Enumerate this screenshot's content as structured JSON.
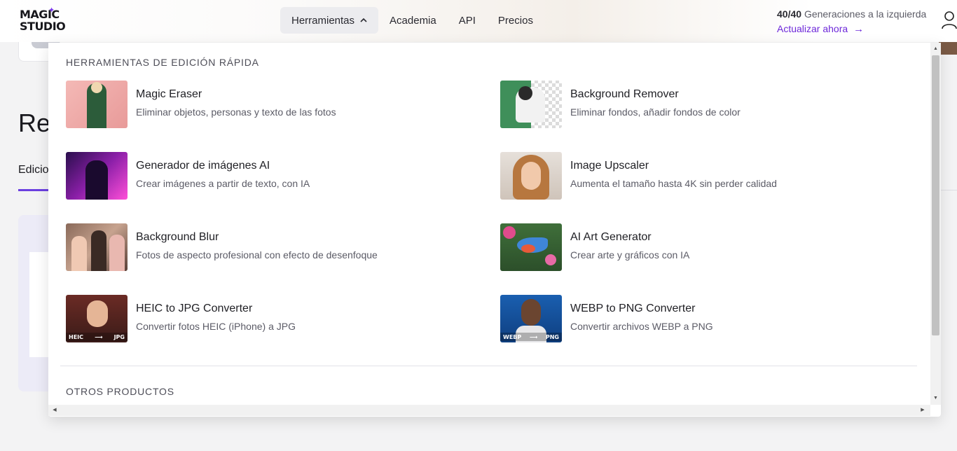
{
  "header": {
    "logo_line1": "MAGIC",
    "logo_line2": "STUDIO",
    "nav": [
      {
        "label": "Herramientas",
        "active": true
      },
      {
        "label": "Academia"
      },
      {
        "label": "API"
      },
      {
        "label": "Precios"
      }
    ],
    "generations_count": "40/40",
    "generations_text": "Generaciones a la izquierda",
    "upgrade_label": "Actualizar ahora",
    "accent_color": "#6d28d9"
  },
  "background": {
    "heading": "Rec",
    "tab_label": "Edicio"
  },
  "dropdown": {
    "section_quick": "HERRAMIENTAS DE EDICIÓN RÁPIDA",
    "section_other": "OTROS PRODUCTOS",
    "tools": [
      {
        "title": "Magic Eraser",
        "desc": "Eliminar objetos, personas y texto de las fotos",
        "icon": "magic-eraser-thumbnail"
      },
      {
        "title": "Background Remover",
        "desc": "Eliminar fondos, añadir fondos de color",
        "icon": "background-remover-thumbnail"
      },
      {
        "title": "Generador de imágenes AI",
        "desc": "Crear imágenes a partir de texto, con IA",
        "icon": "ai-image-generator-thumbnail"
      },
      {
        "title": "Image Upscaler",
        "desc": "Aumenta el tamaño hasta 4K sin perder calidad",
        "icon": "image-upscaler-thumbnail"
      },
      {
        "title": "Background Blur",
        "desc": "Fotos de aspecto profesional con efecto de desenfoque",
        "icon": "background-blur-thumbnail"
      },
      {
        "title": "AI Art Generator",
        "desc": "Crear arte y gráficos con IA",
        "icon": "ai-art-generator-thumbnail"
      },
      {
        "title": "HEIC to JPG Converter",
        "desc": "Convertir fotos HEIC (iPhone) a JPG",
        "icon": "heic-to-jpg-thumbnail",
        "from": "HEIC",
        "to": "JPG"
      },
      {
        "title": "WEBP to PNG Converter",
        "desc": "Convertir archivos WEBP a PNG",
        "icon": "webp-to-png-thumbnail",
        "from": "WEBP",
        "to": "PNG"
      }
    ]
  }
}
